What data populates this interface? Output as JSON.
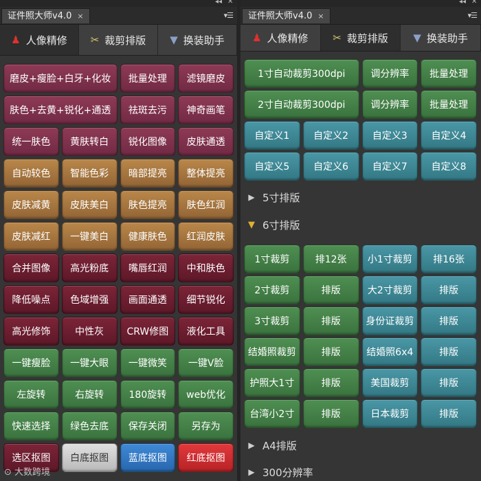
{
  "left": {
    "title": "证件照大师v4.0",
    "close": "×",
    "tabs": [
      "人像精修",
      "裁剪排版",
      "换装助手"
    ],
    "buttons": [
      {
        "label": "磨皮+瘦脸+白牙+化妆",
        "color": "m",
        "span": 2
      },
      {
        "label": "批量处理",
        "color": "m"
      },
      {
        "label": "滤镜磨皮",
        "color": "m"
      },
      {
        "label": "肤色+去黄+锐化+通透",
        "color": "m",
        "span": 2
      },
      {
        "label": "祛斑去污",
        "color": "m"
      },
      {
        "label": "神奇画笔",
        "color": "m"
      },
      {
        "label": "统一肤色",
        "color": "m"
      },
      {
        "label": "黄肤转白",
        "color": "m"
      },
      {
        "label": "锐化图像",
        "color": "m"
      },
      {
        "label": "皮肤通透",
        "color": "m"
      },
      {
        "label": "自动较色",
        "color": "o"
      },
      {
        "label": "智能色彩",
        "color": "o"
      },
      {
        "label": "暗部提亮",
        "color": "o"
      },
      {
        "label": "整体提亮",
        "color": "o"
      },
      {
        "label": "皮肤减黄",
        "color": "o"
      },
      {
        "label": "皮肤美白",
        "color": "o"
      },
      {
        "label": "肤色提亮",
        "color": "o"
      },
      {
        "label": "肤色红润",
        "color": "o"
      },
      {
        "label": "皮肤减红",
        "color": "o"
      },
      {
        "label": "一键美白",
        "color": "o"
      },
      {
        "label": "健康肤色",
        "color": "o"
      },
      {
        "label": "红润皮肤",
        "color": "o"
      },
      {
        "label": "合并图像",
        "color": "d"
      },
      {
        "label": "高光粉底",
        "color": "d"
      },
      {
        "label": "嘴唇红润",
        "color": "d"
      },
      {
        "label": "中和肤色",
        "color": "d"
      },
      {
        "label": "降低噪点",
        "color": "d"
      },
      {
        "label": "色域增强",
        "color": "d"
      },
      {
        "label": "画面通透",
        "color": "d"
      },
      {
        "label": "细节锐化",
        "color": "d"
      },
      {
        "label": "高光修饰",
        "color": "d"
      },
      {
        "label": "中性灰",
        "color": "d"
      },
      {
        "label": "CRW修图",
        "color": "d"
      },
      {
        "label": "液化工具",
        "color": "d"
      },
      {
        "label": "一键瘦脸",
        "color": "g"
      },
      {
        "label": "一键大眼",
        "color": "g"
      },
      {
        "label": "一键微笑",
        "color": "g"
      },
      {
        "label": "一键V脸",
        "color": "g"
      },
      {
        "label": "左旋转",
        "color": "g"
      },
      {
        "label": "右旋转",
        "color": "g"
      },
      {
        "label": "180旋转",
        "color": "g"
      },
      {
        "label": "web优化",
        "color": "g"
      },
      {
        "label": "快速选择",
        "color": "g"
      },
      {
        "label": "绿色去底",
        "color": "g"
      },
      {
        "label": "保存关闭",
        "color": "g"
      },
      {
        "label": "另存为",
        "color": "g"
      },
      {
        "label": "选区抠图",
        "color": "d"
      },
      {
        "label": "白底抠图",
        "color": "w"
      },
      {
        "label": "蓝底抠图",
        "color": "b"
      },
      {
        "label": "红底抠图",
        "color": "r"
      }
    ]
  },
  "right": {
    "title": "证件照大师v4.0",
    "close": "×",
    "tabs": [
      "人像精修",
      "裁剪排版",
      "换装助手"
    ],
    "top_buttons": [
      {
        "label": "1寸自动裁剪300dpi",
        "color": "g",
        "span": 2
      },
      {
        "label": "调分辨率",
        "color": "g"
      },
      {
        "label": "批量处理",
        "color": "g"
      },
      {
        "label": "2寸自动裁剪300dpi",
        "color": "g",
        "span": 2
      },
      {
        "label": "调分辨率",
        "color": "g"
      },
      {
        "label": "批量处理",
        "color": "g"
      },
      {
        "label": "自定义1",
        "color": "t"
      },
      {
        "label": "自定义2",
        "color": "t"
      },
      {
        "label": "自定义3",
        "color": "t"
      },
      {
        "label": "自定义4",
        "color": "t"
      },
      {
        "label": "自定义5",
        "color": "t"
      },
      {
        "label": "自定义6",
        "color": "t"
      },
      {
        "label": "自定义7",
        "color": "t"
      },
      {
        "label": "自定义8",
        "color": "t"
      }
    ],
    "sections": {
      "s5": "5寸排版",
      "s6": "6寸排版",
      "a4": "A4排版",
      "dpi": "300分辨率"
    },
    "six_buttons": [
      {
        "label": "1寸裁剪",
        "color": "g"
      },
      {
        "label": "排12张",
        "color": "g"
      },
      {
        "label": "小1寸裁剪",
        "color": "t"
      },
      {
        "label": "排16张",
        "color": "t"
      },
      {
        "label": "2寸裁剪",
        "color": "g"
      },
      {
        "label": "排版",
        "color": "g"
      },
      {
        "label": "大2寸裁剪",
        "color": "t"
      },
      {
        "label": "排版",
        "color": "t"
      },
      {
        "label": "3寸裁剪",
        "color": "g"
      },
      {
        "label": "排版",
        "color": "g"
      },
      {
        "label": "身份证裁剪",
        "color": "t"
      },
      {
        "label": "排版",
        "color": "t"
      },
      {
        "label": "结婚照裁剪",
        "color": "g"
      },
      {
        "label": "排版",
        "color": "g"
      },
      {
        "label": "结婚照6x4",
        "color": "t"
      },
      {
        "label": "排版",
        "color": "t"
      },
      {
        "label": "护照大1寸",
        "color": "g"
      },
      {
        "label": "排版",
        "color": "g"
      },
      {
        "label": "美国裁剪",
        "color": "t"
      },
      {
        "label": "排版",
        "color": "t"
      },
      {
        "label": "台湾小2寸",
        "color": "g"
      },
      {
        "label": "排版",
        "color": "g"
      },
      {
        "label": "日本裁剪",
        "color": "t"
      },
      {
        "label": "排版",
        "color": "t"
      }
    ]
  },
  "watermark": "大数跨境",
  "icons": {
    "collapse": "double-chevron-left-icon",
    "menu": "panel-menu-icon"
  }
}
